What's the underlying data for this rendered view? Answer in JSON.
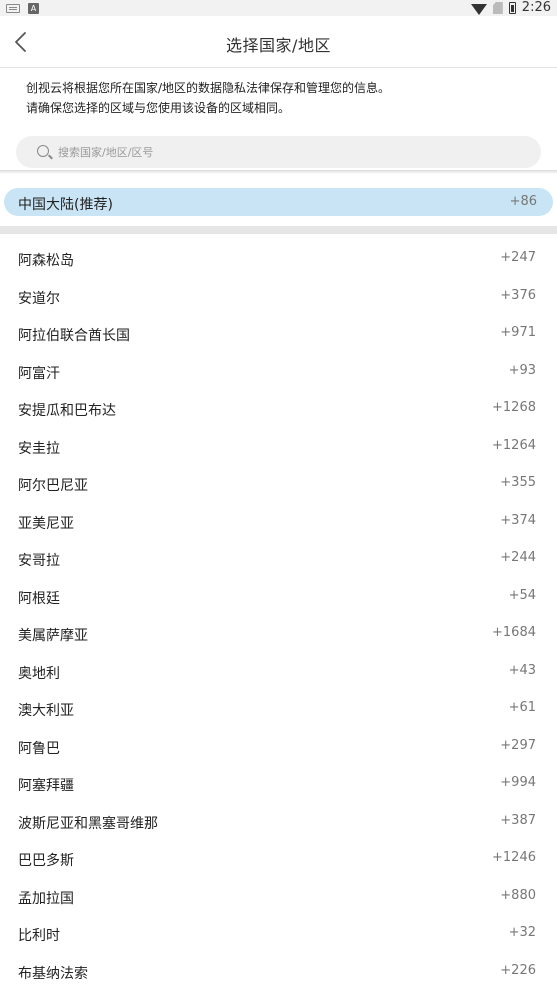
{
  "status_bar": {
    "time": "2:26"
  },
  "header": {
    "title": "选择国家/地区"
  },
  "notice": {
    "line1": "创视云将根据您所在国家/地区的数据隐私法律保存和管理您的信息。",
    "line2": "请确保您选择的区域与您使用该设备的区域相同。"
  },
  "search": {
    "placeholder": "搜索国家/地区/区号"
  },
  "recommended": {
    "name": "中国大陆(推荐)",
    "code": "+86"
  },
  "countries": [
    {
      "name": "阿森松岛",
      "code": "+247"
    },
    {
      "name": "安道尔",
      "code": "+376"
    },
    {
      "name": "阿拉伯联合酋长国",
      "code": "+971"
    },
    {
      "name": "阿富汗",
      "code": "+93"
    },
    {
      "name": "安提瓜和巴布达",
      "code": "+1268"
    },
    {
      "name": "安圭拉",
      "code": "+1264"
    },
    {
      "name": "阿尔巴尼亚",
      "code": "+355"
    },
    {
      "name": "亚美尼亚",
      "code": "+374"
    },
    {
      "name": "安哥拉",
      "code": "+244"
    },
    {
      "name": "阿根廷",
      "code": "+54"
    },
    {
      "name": "美属萨摩亚",
      "code": "+1684"
    },
    {
      "name": "奥地利",
      "code": "+43"
    },
    {
      "name": "澳大利亚",
      "code": "+61"
    },
    {
      "name": "阿鲁巴",
      "code": "+297"
    },
    {
      "name": "阿塞拜疆",
      "code": "+994"
    },
    {
      "name": "波斯尼亚和黑塞哥维那",
      "code": "+387"
    },
    {
      "name": "巴巴多斯",
      "code": "+1246"
    },
    {
      "name": "孟加拉国",
      "code": "+880"
    },
    {
      "name": "比利时",
      "code": "+32"
    },
    {
      "name": "布基纳法索",
      "code": "+226"
    }
  ]
}
